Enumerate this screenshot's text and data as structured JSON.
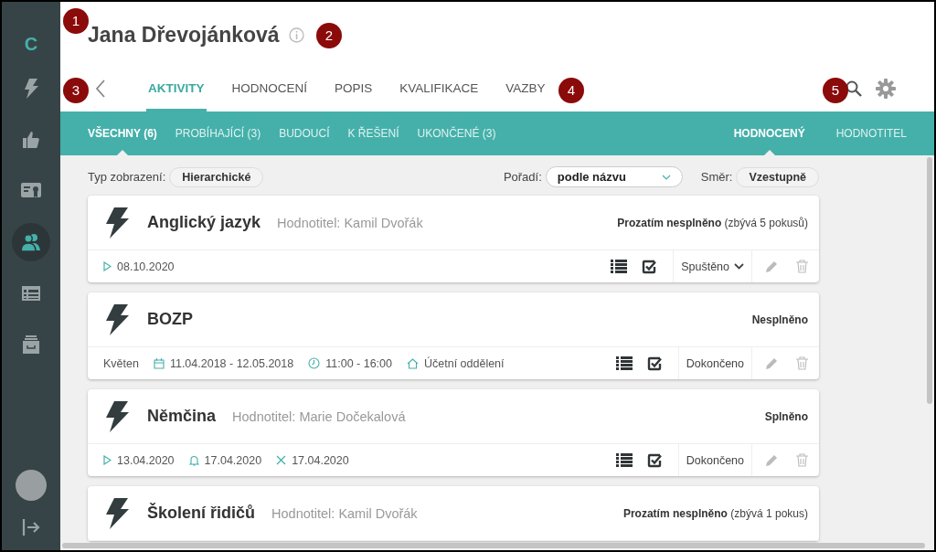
{
  "sidebar": {
    "logo": "C",
    "items": [
      {
        "kind": "bolt",
        "selected": false
      },
      {
        "kind": "thumbs-up",
        "selected": false
      },
      {
        "kind": "certificate",
        "selected": false
      },
      {
        "kind": "people",
        "selected": true
      },
      {
        "kind": "table",
        "selected": false
      },
      {
        "kind": "archive",
        "selected": false
      }
    ]
  },
  "header": {
    "title": "Jana Dřevojánková"
  },
  "tabs": [
    {
      "label": "AKTIVITY",
      "selected": true
    },
    {
      "label": "HODNOCENÍ",
      "selected": false
    },
    {
      "label": "POPIS",
      "selected": false
    },
    {
      "label": "KVALIFIKACE",
      "selected": false
    },
    {
      "label": "VAZBY",
      "selected": false
    }
  ],
  "filter_tabs": [
    {
      "label": "VŠECHNY (6)",
      "selected": true
    },
    {
      "label": "PROBÍHAJÍCÍ (3)",
      "selected": false
    },
    {
      "label": "BUDOUCÍ",
      "selected": false
    },
    {
      "label": "K ŘEŠENÍ",
      "selected": false
    },
    {
      "label": "UKONČENÉ (3)",
      "selected": false
    }
  ],
  "role_tabs": [
    {
      "label": "HODNOCENÝ",
      "selected": true
    },
    {
      "label": "HODNOTITEL",
      "selected": false
    }
  ],
  "view_options": {
    "type_label": "Typ zobrazení:",
    "type_value": "Hierarchické",
    "order_label": "Pořadí:",
    "order_value": "podle názvu",
    "direction_label": "Směr:",
    "direction_value": "Vzestupně"
  },
  "activities": [
    {
      "title": "Anglický jazyk",
      "evaluator": "Hodnotitel: Kamil Dvořák",
      "result": "Prozatím nesplněno",
      "result_note": "(zbývá 5 pokusů)",
      "footer": {
        "items": [
          {
            "kind": "start",
            "text": "08.10.2020"
          }
        ],
        "status": "Spuštěno",
        "status_dropdown": true
      }
    },
    {
      "title": "BOZP",
      "result": "Nesplněno",
      "footer": {
        "items": [
          {
            "kind": "text",
            "text": "Květen"
          },
          {
            "kind": "date-range",
            "text": "11.04.2018 - 12.05.2018"
          },
          {
            "kind": "time",
            "text": "11:00 - 16:00"
          },
          {
            "kind": "place",
            "text": "Účetní oddělení"
          }
        ],
        "status": "Dokončeno",
        "status_dropdown": false
      }
    },
    {
      "title": "Němčina",
      "evaluator": "Hodnotitel: Marie Dočekalová",
      "result": "Splněno",
      "footer": {
        "items": [
          {
            "kind": "start",
            "text": "13.04.2020"
          },
          {
            "kind": "reminder",
            "text": "17.04.2020"
          },
          {
            "kind": "end",
            "text": "17.04.2020"
          }
        ],
        "status": "Dokončeno",
        "status_dropdown": false
      }
    },
    {
      "title": "Školení řidičů",
      "evaluator": "Hodnotitel: Kamil Dvořák",
      "result": "Prozatím nesplněno",
      "result_note": "(zbývá 1 pokus)"
    }
  ],
  "callouts": [
    {
      "number": "1"
    },
    {
      "number": "2"
    },
    {
      "number": "3"
    },
    {
      "number": "4"
    },
    {
      "number": "5"
    }
  ]
}
